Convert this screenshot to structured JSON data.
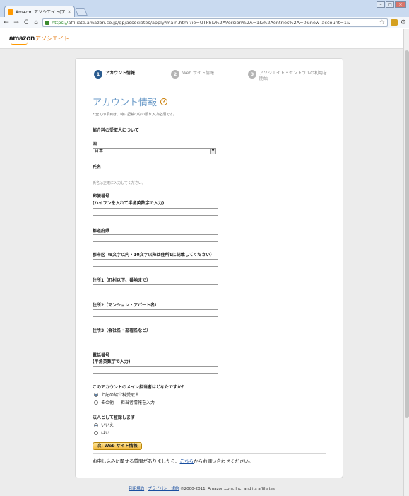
{
  "browser": {
    "tab_title": "Amazon アソシエイト(アフィリエ",
    "tab_close": "×",
    "url_scheme": "https://",
    "url_rest": "affiliate.amazon.co.jp/gp/associates/apply/main.html?ie=UTF8&%2AVersion%2A=1&%2Aentries%2A=0&new_account=1&",
    "back": "←",
    "forward": "→",
    "reload": "C",
    "home": "⌂",
    "star": "☆",
    "wrench": "🔧"
  },
  "header": {
    "logo_brand": "amazon",
    "logo_suffix": "アソシエイト"
  },
  "steps": [
    {
      "num": "1",
      "label": "アカウント情報"
    },
    {
      "num": "2",
      "label": "Web サイト情報"
    },
    {
      "num": "3",
      "label": "アソシエイト・セントラルの利用を開始"
    }
  ],
  "form": {
    "title": "アカウント情報",
    "help_glyph": "?",
    "required_note": "* 全ての項目は、特に記載のない限り入力必須です。",
    "section_payee": "紹介料の受取人について",
    "country_label": "国",
    "country_value": "日本",
    "name_label": "氏名",
    "name_hint": "氏名は正確に入力してください。",
    "postal_label": "郵便番号",
    "postal_sub": "(ハイフンを入れて半角英数字で入力)",
    "pref_label": "都道府県",
    "city_label": "郡市区（9文字以内・10文字以降は住所1に記載してください）",
    "addr1_label": "住所1（町村以下、番地まで）",
    "addr2_label": "住所2（マンション・アパート名）",
    "addr3_label": "住所3（会社名・部署名など）",
    "phone_label": "電話番号",
    "phone_sub": "(半角英数字で入力)",
    "contact_q": "このアカウントのメイン担当者はどなたですか？",
    "contact_opts": [
      "上記の紹介料受取人",
      "その他 ― 担当者情報を入力"
    ],
    "corp_q": "法人として登録します",
    "corp_opts": [
      "いいえ",
      "はい"
    ],
    "next_button": "次: Web サイト情報",
    "contact_pre": "お申し込みに関する質問がありましたら、",
    "contact_link": "こちら",
    "contact_post": "からお問い合わせください。"
  },
  "footer": {
    "terms": "利用規約",
    "sep": " | ",
    "privacy": "プライバシー規約",
    "copyright": " ©2000-2011, Amazon.com, Inc. and its affiliates"
  }
}
